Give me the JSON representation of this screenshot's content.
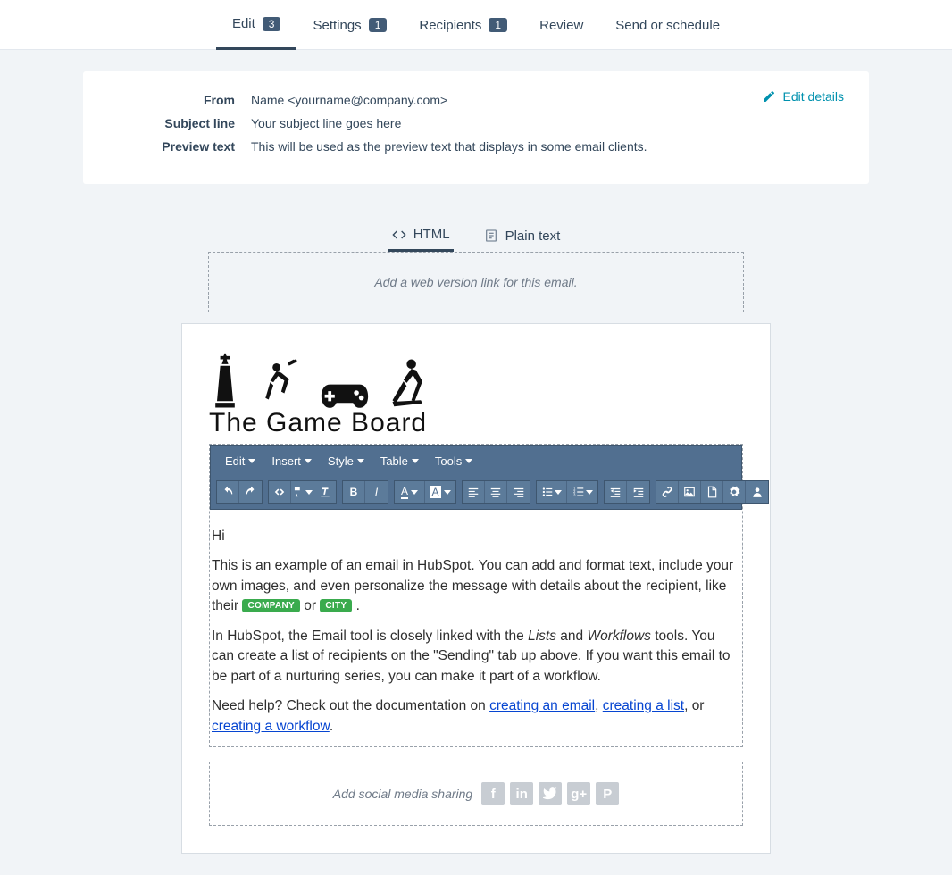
{
  "tabs": {
    "edit": {
      "label": "Edit",
      "badge": "3"
    },
    "settings": {
      "label": "Settings",
      "badge": "1"
    },
    "recipients": {
      "label": "Recipients",
      "badge": "1"
    },
    "review": {
      "label": "Review"
    },
    "send": {
      "label": "Send or schedule"
    }
  },
  "details": {
    "from_label": "From",
    "from_value": "Name <yourname@company.com>",
    "subject_label": "Subject line",
    "subject_value": "Your subject line goes here",
    "preview_label": "Preview text",
    "preview_value": "This will be used as the preview text that displays in some email clients.",
    "edit_details": "Edit details"
  },
  "viewTabs": {
    "html": "HTML",
    "plain": "Plain text"
  },
  "webVersion": "Add a web version link for this email.",
  "logoText": "The Game Board",
  "editorMenus": {
    "edit": "Edit",
    "insert": "Insert",
    "style": "Style",
    "table": "Table",
    "tools": "Tools"
  },
  "body": {
    "greeting": "Hi",
    "p1a": "This is an example of an email in HubSpot. You can add and format text, include your own images, and even personalize the message with details about the recipient, like their ",
    "token1": "COMPANY",
    "or": " or ",
    "token2": "CITY",
    "p1b": ".",
    "p2a": "In HubSpot, the Email tool is closely linked with the ",
    "lists": "Lists",
    "p2b": " and ",
    "workflows": "Workflows",
    "p2c": " tools. You can create a list of recipients on the \"Sending\" tab up above. If you want this email to be part of a nurturing series, you can make it part of a workflow.",
    "p3a": "Need help? Check out the documentation on ",
    "link1": "creating an email",
    "comma1": ", ",
    "link2": "creating a list",
    "comma2": ", or ",
    "link3": "creating a workflow",
    "p3b": "."
  },
  "social": {
    "label": "Add social media sharing",
    "f": "f",
    "in": "in",
    "g": "g+",
    "p": "P"
  }
}
